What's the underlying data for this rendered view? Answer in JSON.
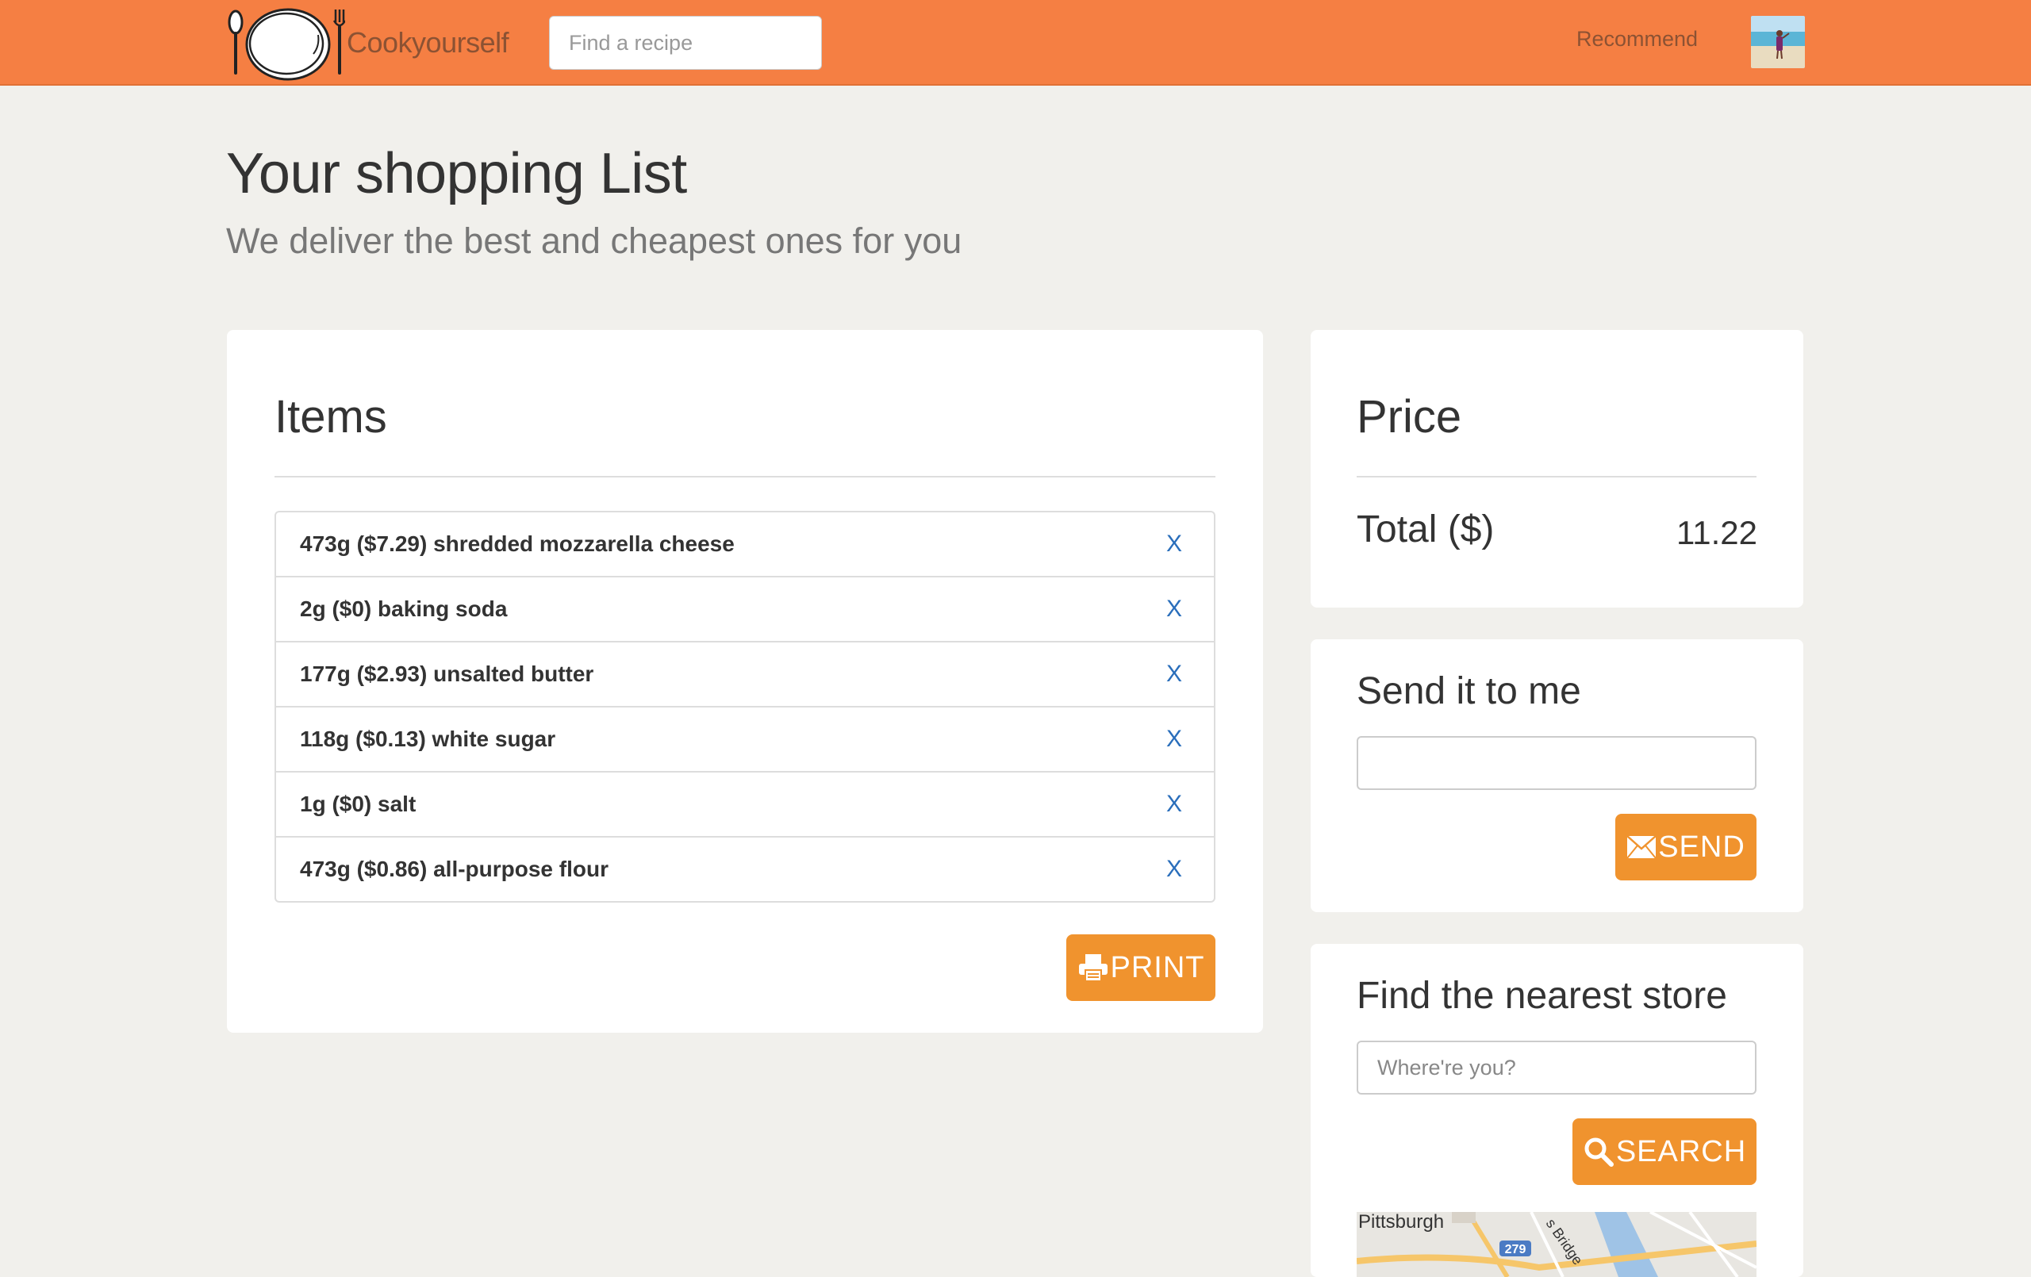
{
  "navbar": {
    "brand": "Cookyourself",
    "search_placeholder": "Find a recipe",
    "recommend_link": "Recommend"
  },
  "header": {
    "title": "Your shopping List",
    "subtitle": "We deliver the best and cheapest ones for you"
  },
  "items_panel": {
    "heading": "Items",
    "remove_label": "X",
    "items": [
      {
        "label": "473g ($7.29) shredded mozzarella cheese"
      },
      {
        "label": "2g ($0) baking soda"
      },
      {
        "label": "177g ($2.93) unsalted butter"
      },
      {
        "label": "118g ($0.13) white sugar"
      },
      {
        "label": "1g ($0) salt"
      },
      {
        "label": "473g ($0.86) all-purpose flour"
      }
    ],
    "print_label": "PRINT",
    "print_icon": "printer-icon"
  },
  "price_panel": {
    "heading": "Price",
    "total_label": "Total ($)",
    "total_value": "11.22"
  },
  "send_panel": {
    "heading": "Send it to me",
    "email_value": "",
    "send_label": "SEND",
    "send_icon": "envelope-icon"
  },
  "store_panel": {
    "heading": "Find the nearest store",
    "location_placeholder": "Where're you?",
    "search_label": "SEARCH",
    "search_icon": "search-icon",
    "map_labels": {
      "city": "Pittsburgh",
      "highway": "279",
      "bridge": "s Bridge"
    }
  },
  "colors": {
    "navbar": "#f57f43",
    "button": "#f0932e",
    "background": "#f1f0ec",
    "link": "#2a6ebb"
  }
}
